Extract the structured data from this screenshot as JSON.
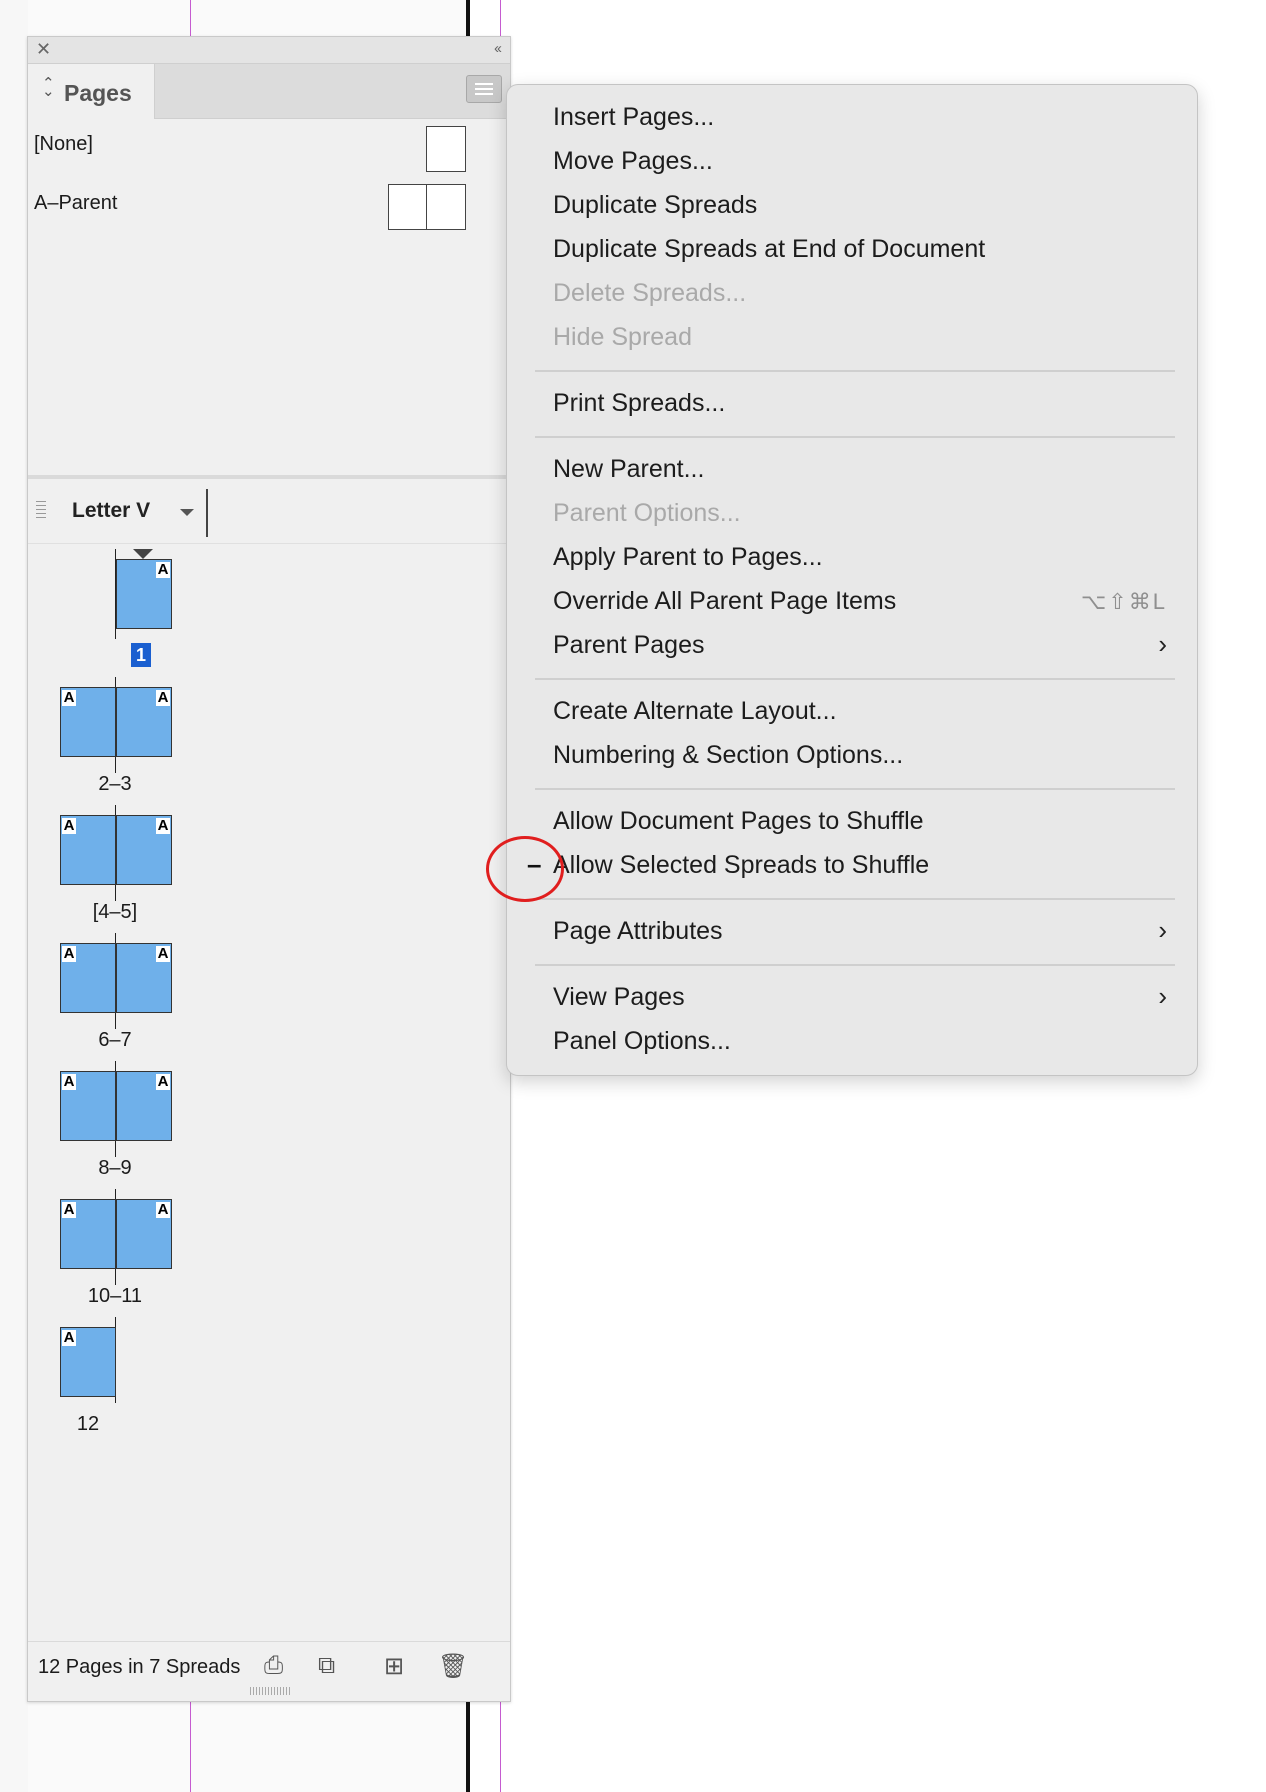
{
  "panel": {
    "tab_label": "Pages",
    "parents": [
      {
        "label": "[None]"
      },
      {
        "label": "A–Parent"
      }
    ],
    "page_size_label": "Letter V",
    "spreads": [
      {
        "label": "1",
        "selected": true
      },
      {
        "label": "2–3"
      },
      {
        "label": "[4–5]"
      },
      {
        "label": "6–7"
      },
      {
        "label": "8–9"
      },
      {
        "label": "10–11"
      },
      {
        "label": "12"
      }
    ],
    "parent_marker": "A",
    "footer_count": "12 Pages in 7 Spreads",
    "footer_icons": [
      "edit-page-size-icon",
      "create-page-icon",
      "new-page-icon",
      "delete-page-icon"
    ]
  },
  "menu": {
    "items": [
      {
        "label": "Insert Pages..."
      },
      {
        "label": "Move Pages..."
      },
      {
        "label": "Duplicate Spreads"
      },
      {
        "label": "Duplicate Spreads at End of Document"
      },
      {
        "label": "Delete Spreads...",
        "disabled": true
      },
      {
        "label": "Hide Spread",
        "disabled": true
      },
      {
        "label": "Print Spreads..."
      },
      {
        "label": "New Parent..."
      },
      {
        "label": "Parent Options...",
        "disabled": true
      },
      {
        "label": "Apply Parent to Pages..."
      },
      {
        "label": "Override All Parent Page Items",
        "shortcut": "⌥⇧⌘L"
      },
      {
        "label": "Parent Pages",
        "submenu": true
      },
      {
        "label": "Create Alternate Layout..."
      },
      {
        "label": "Numbering & Section Options..."
      },
      {
        "label": "Allow Document Pages to Shuffle"
      },
      {
        "label": "Allow Selected Spreads to Shuffle",
        "mixed_state": "–"
      },
      {
        "label": "Page Attributes",
        "submenu": true
      },
      {
        "label": "View Pages",
        "submenu": true
      },
      {
        "label": "Panel Options..."
      }
    ],
    "submenu_glyph": "›"
  },
  "colors": {
    "page_thumb": "#6fb0ea",
    "selection": "#1a5fd0",
    "annotation": "#e01e1e",
    "guide": "#c55bd0"
  }
}
